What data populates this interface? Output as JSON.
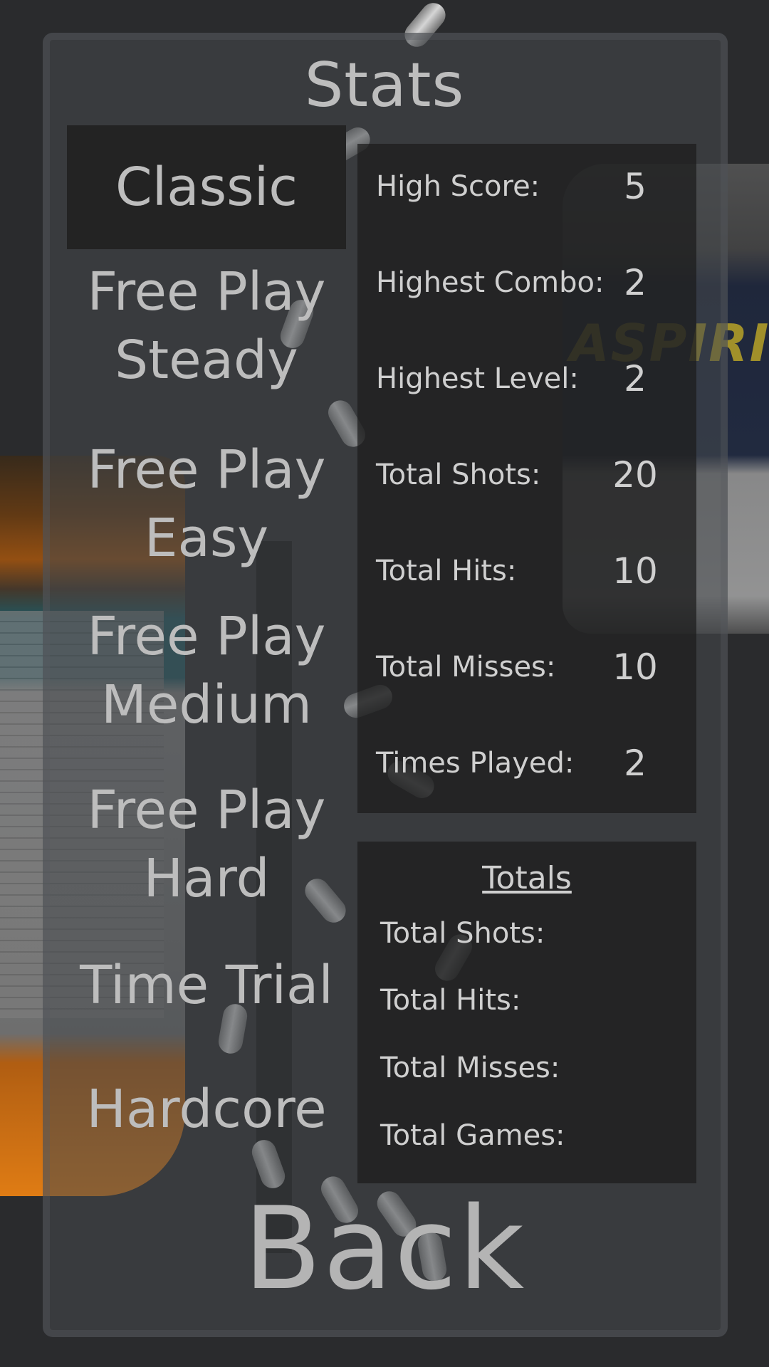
{
  "title": "Stats",
  "modes": [
    {
      "label": "Classic",
      "selected": true
    },
    {
      "label": "Free Play\nSteady",
      "selected": false
    },
    {
      "label": "Free Play\nEasy",
      "selected": false
    },
    {
      "label": "Free Play\nMedium",
      "selected": false
    },
    {
      "label": "Free Play\nHard",
      "selected": false
    },
    {
      "label": "Time Trial",
      "selected": false
    },
    {
      "label": "Hardcore",
      "selected": false
    }
  ],
  "stats": [
    {
      "label": "High Score:",
      "value": "5"
    },
    {
      "label": "Highest Combo:",
      "value": "2"
    },
    {
      "label": "Highest Level:",
      "value": "2"
    },
    {
      "label": "Total Shots:",
      "value": "20"
    },
    {
      "label": "Total Hits:",
      "value": "10"
    },
    {
      "label": "Total Misses:",
      "value": "10"
    },
    {
      "label": "Times Played:",
      "value": "2"
    }
  ],
  "totals": {
    "title": "Totals",
    "items": [
      "Total Shots:",
      "Total Hits:",
      "Total Misses:",
      "Total Games:"
    ]
  },
  "background": {
    "brand_text": "ASPIRIN"
  },
  "back_label": "Back"
}
